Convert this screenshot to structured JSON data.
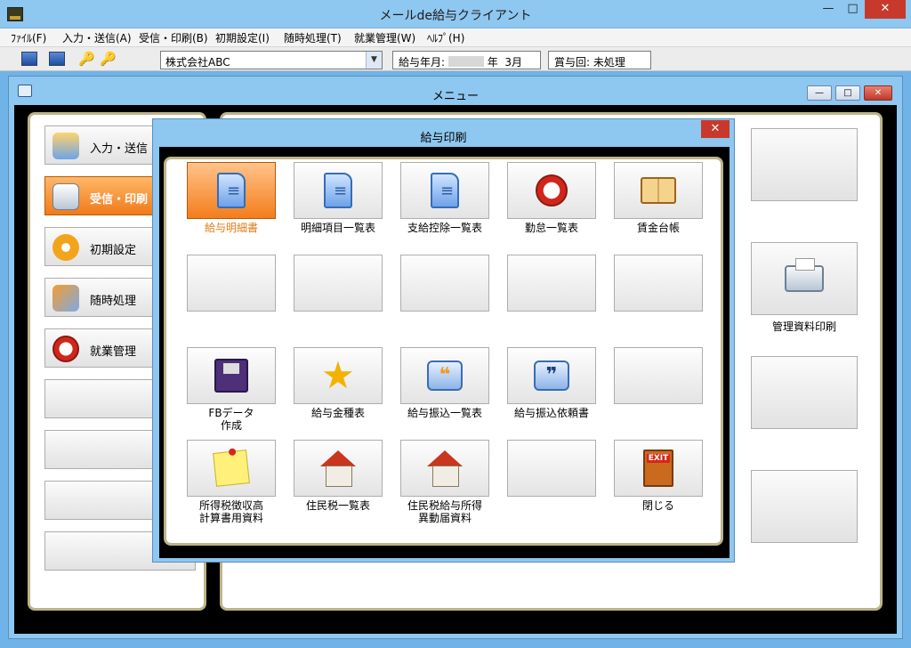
{
  "app": {
    "title": "メールde給与クライアント",
    "window_controls": {
      "minimize": "—",
      "maximize": "□",
      "close": "✕"
    }
  },
  "menubar": {
    "items": [
      "ﾌｧｲﾙ(F)",
      "入力・送信(A)",
      "受信・印刷(B)",
      "初期設定(I)",
      "随時処理(T)",
      "就業管理(W)",
      "ﾍﾙﾌﾟ(H)"
    ]
  },
  "toolbar": {
    "icons": [
      "image-icon",
      "image-icon",
      "key-icon",
      "key-icon"
    ],
    "company": "株式会社ABC",
    "pay_period_label": "給与年月:",
    "pay_period_year_suffix": "年",
    "pay_period_month": "3月",
    "bonus_label": "賞与回:",
    "bonus_value": "未処理"
  },
  "menu_window": {
    "title": "メニュー",
    "controls": {
      "minimize": "—",
      "maximize": "□",
      "close": "✕"
    },
    "sidebar": [
      {
        "label": "入力・送信",
        "icon": "input-send-icon",
        "active": false
      },
      {
        "label": "受信・印刷",
        "icon": "receive-print-icon",
        "active": true
      },
      {
        "label": "初期設定",
        "icon": "gear-icon",
        "active": false
      },
      {
        "label": "随時処理",
        "icon": "tools-icon",
        "active": false
      },
      {
        "label": "就業管理",
        "icon": "clock-icon",
        "active": false
      }
    ],
    "right_buttons": [
      {
        "label": ""
      },
      {
        "label": "管理資料印刷",
        "icon": "printer-icon"
      },
      {
        "label": ""
      },
      {
        "label": ""
      }
    ]
  },
  "dialog": {
    "title": "給与印刷",
    "close": "✕",
    "buttons": [
      {
        "label": "給与明細書",
        "icon": "document-icon",
        "selected": true
      },
      {
        "label": "明細項目一覧表",
        "icon": "document-list-icon"
      },
      {
        "label": "支給控除一覧表",
        "icon": "document-list-icon"
      },
      {
        "label": "勤怠一覧表",
        "icon": "alarm-clock-icon"
      },
      {
        "label": "賃金台帳",
        "icon": "open-book-icon"
      },
      {
        "label": ""
      },
      {
        "label": ""
      },
      {
        "label": ""
      },
      {
        "label": ""
      },
      {
        "label": ""
      },
      {
        "label": "FBデータ\n作成",
        "icon": "floppy-disk-icon"
      },
      {
        "label": "給与金種表",
        "icon": "star-icon"
      },
      {
        "label": "給与振込一覧表",
        "icon": "quote-bubble-icon"
      },
      {
        "label": "給与振込依頼書",
        "icon": "quote-folder-icon"
      },
      {
        "label": ""
      },
      {
        "label": "所得税徴収高\n計算書用資料",
        "icon": "sticky-note-icon"
      },
      {
        "label": "住民税一覧表",
        "icon": "house-icon"
      },
      {
        "label": "住民税給与所得\n異動届資料",
        "icon": "house-person-icon"
      },
      {
        "label": ""
      },
      {
        "label": "閉じる",
        "icon": "exit-door-icon"
      }
    ]
  }
}
